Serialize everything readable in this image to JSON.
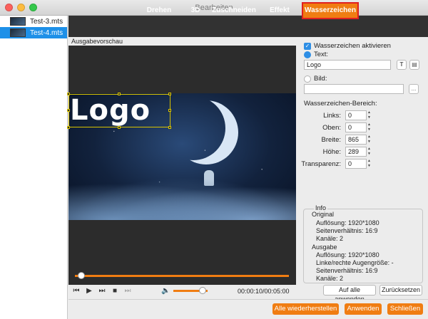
{
  "window": {
    "title": "Bearbeiten"
  },
  "sidebar": {
    "files": [
      {
        "name": "Test-3.mts"
      },
      {
        "name": "Test-4.mts",
        "selected": true
      }
    ]
  },
  "tabs": [
    "Drehen",
    "3D",
    "Zuschneiden",
    "Effekt",
    "Wasserzeichen"
  ],
  "active_tab": "Wasserzeichen",
  "preview": {
    "label": "Ausgabevorschau",
    "watermark_text": "Logo",
    "timecode": "00:00:10/00:05:00",
    "progress": 0.03,
    "volume": 0.85
  },
  "watermark": {
    "enable_label": "Wasserzeichen aktivieren",
    "enabled": true,
    "text_label": "Text:",
    "text_value": "Logo",
    "image_label": "Bild:",
    "image_value": "",
    "browse_label": "...",
    "area_label": "Wasserzeichen-Bereich:",
    "links_label": "Links:",
    "links": "0",
    "oben_label": "Oben:",
    "oben": "0",
    "breite_label": "Breite:",
    "breite": "865",
    "hoehe_label": "Höhe:",
    "hoehe": "289",
    "transparenz_label": "Transparenz:",
    "transparenz": "0"
  },
  "info": {
    "title": "Info",
    "original_label": "Original",
    "original_resolution": "Auflösung: 1920*1080",
    "original_aspect": "Seitenverhältnis: 16:9",
    "original_channels": "Kanäle: 2",
    "output_label": "Ausgabe",
    "output_resolution": "Auflösung: 1920*1080",
    "output_eye": "Linke/rechte Augengröße: -",
    "output_aspect": "Seitenverhältnis: 16:9",
    "output_channels": "Kanäle: 2"
  },
  "buttons": {
    "apply_all": "Auf alle anwenden",
    "reset": "Zurücksetzen",
    "restore_all": "Alle wiederherstellen",
    "apply": "Anwenden",
    "close": "Schließen"
  },
  "colors": {
    "accent": "#f07d12",
    "selection": "#1e90e8",
    "tab_highlight": "#e02020"
  }
}
